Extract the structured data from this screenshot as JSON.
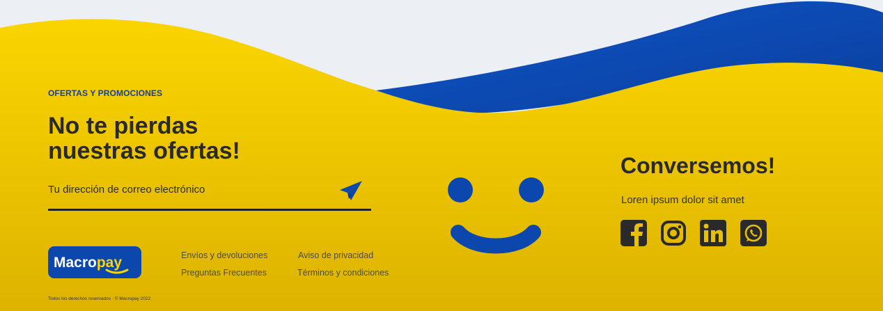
{
  "colors": {
    "yellow_top": "#f9d300",
    "yellow_bottom": "#dfb400",
    "blue": "#0b47ad",
    "background": "#eceff4",
    "dark_text": "#2a2a2a"
  },
  "newsletter": {
    "eyebrow": "OFERTAS Y PROMOCIONES",
    "headline": "No te pierdas nuestras ofertas!",
    "email_placeholder": "Tu dirección de correo electrónico",
    "send_icon": "paper-plane-icon"
  },
  "brand": {
    "logo_text_1": "Macro",
    "logo_text_2": "pay"
  },
  "footer_links": [
    {
      "label": "Envíos y devoluciones"
    },
    {
      "label": "Preguntas Frecuentes"
    },
    {
      "label": "Aviso de privacidad"
    },
    {
      "label": "Términos y condiciones"
    }
  ],
  "copyright": "Todos los derechos reservados · © Macropay 2022",
  "contact": {
    "title": "Conversemos!",
    "subtitle": "Loren ipsum dolor sit amet",
    "social": [
      {
        "icon": "facebook-icon"
      },
      {
        "icon": "instagram-icon"
      },
      {
        "icon": "linkedin-icon"
      },
      {
        "icon": "whatsapp-icon"
      }
    ]
  }
}
